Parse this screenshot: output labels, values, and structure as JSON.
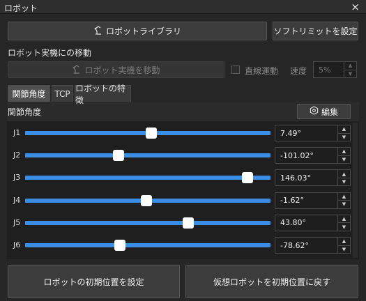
{
  "window": {
    "title": "ロボット",
    "close_icon": "×"
  },
  "toolbar": {
    "robot_library_label": "ロボットライブラリ",
    "soft_limit_label": "ソフトリミットを設定"
  },
  "move_section": {
    "heading": "ロボット実機にの移動",
    "move_button_label": "ロボット実機を移動",
    "linear_motion_label": "直線運動",
    "speed_label": "速度",
    "speed_value": "5%"
  },
  "tabs": [
    {
      "label": "関節角度",
      "active": true
    },
    {
      "label": "TCP",
      "active": false
    },
    {
      "label": "ロボットの特徴",
      "active": false
    }
  ],
  "joint_section": {
    "heading": "関節角度",
    "edit_label": "編集",
    "edit_icon": "hexagon-gear-icon"
  },
  "joints": [
    {
      "label": "J1",
      "value": "7.49°",
      "position": 0.515
    },
    {
      "label": "J2",
      "value": "-101.02°",
      "position": 0.381
    },
    {
      "label": "J3",
      "value": "146.03°",
      "position": 0.905
    },
    {
      "label": "J4",
      "value": "-1.62°",
      "position": 0.493
    },
    {
      "label": "J5",
      "value": "43.80°",
      "position": 0.666
    },
    {
      "label": "J6",
      "value": "-78.62°",
      "position": 0.386
    }
  ],
  "footer": {
    "set_initial_label": "ロボットの初期位置を設定",
    "reset_virtual_label": "仮想ロボットを初期位置に戻す"
  },
  "colors": {
    "accent": "#3a8ee6",
    "background": "#262626"
  }
}
